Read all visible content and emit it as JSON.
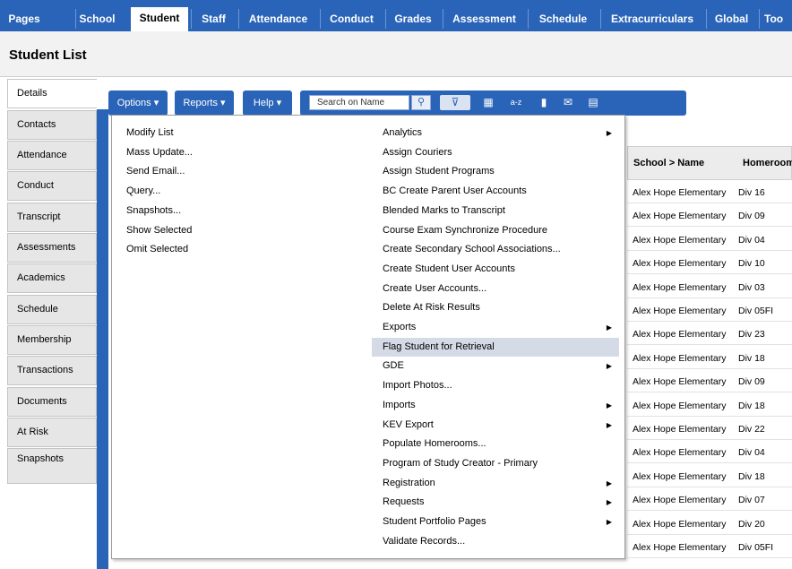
{
  "top_tabs": [
    "Pages",
    "School",
    "Student",
    "Staff",
    "Attendance",
    "Conduct",
    "Grades",
    "Assessment",
    "Schedule",
    "Extracurriculars",
    "Global",
    "Too"
  ],
  "active_top_tab": "Student",
  "page_title": "Student List",
  "side_tabs": [
    "Details",
    "Contacts",
    "Attendance",
    "Conduct",
    "Transcript",
    "Assessments",
    "Academics",
    "Schedule",
    "Membership",
    "Transactions",
    "Documents",
    "At Risk",
    "Snapshots"
  ],
  "toolbar": {
    "options_label": "Options",
    "reports_label": "Reports",
    "help_label": "Help",
    "search_placeholder": "Search on Name"
  },
  "options_menu": [
    "Modify List",
    "Mass Update...",
    "Send Email...",
    "Query...",
    "Snapshots...",
    "Show Selected",
    "Omit Selected"
  ],
  "submenu": [
    {
      "label": "Analytics",
      "arrow": true
    },
    {
      "label": "Assign Couriers",
      "arrow": false
    },
    {
      "label": "Assign Student Programs",
      "arrow": false
    },
    {
      "label": "BC Create Parent User Accounts",
      "arrow": false
    },
    {
      "label": "Blended Marks to Transcript",
      "arrow": false
    },
    {
      "label": "Course Exam Synchronize Procedure",
      "arrow": false
    },
    {
      "label": "Create Secondary School Associations...",
      "arrow": false
    },
    {
      "label": "Create Student User Accounts",
      "arrow": false
    },
    {
      "label": "Create User Accounts...",
      "arrow": false
    },
    {
      "label": "Delete At Risk Results",
      "arrow": false
    },
    {
      "label": "Exports",
      "arrow": true
    },
    {
      "label": "Flag Student for Retrieval",
      "arrow": false,
      "highlighted": true
    },
    {
      "label": "GDE",
      "arrow": true
    },
    {
      "label": "Import Photos...",
      "arrow": false
    },
    {
      "label": "Imports",
      "arrow": true
    },
    {
      "label": "KEV Export",
      "arrow": true
    },
    {
      "label": "Populate Homerooms...",
      "arrow": false
    },
    {
      "label": "Program of Study Creator - Primary",
      "arrow": false
    },
    {
      "label": "Registration",
      "arrow": true
    },
    {
      "label": "Requests",
      "arrow": true
    },
    {
      "label": "Student Portfolio Pages",
      "arrow": true
    },
    {
      "label": "Validate Records...",
      "arrow": false
    }
  ],
  "table": {
    "headers": [
      "School > Name",
      "Homeroom"
    ],
    "rows": [
      [
        "Alex Hope Elementary",
        "Div 16"
      ],
      [
        "Alex Hope Elementary",
        "Div 09"
      ],
      [
        "Alex Hope Elementary",
        "Div 04"
      ],
      [
        "Alex Hope Elementary",
        "Div 10"
      ],
      [
        "Alex Hope Elementary",
        "Div 03"
      ],
      [
        "Alex Hope Elementary",
        "Div 05FI"
      ],
      [
        "Alex Hope Elementary",
        "Div 23"
      ],
      [
        "Alex Hope Elementary",
        "Div 18"
      ],
      [
        "Alex Hope Elementary",
        "Div 09"
      ],
      [
        "Alex Hope Elementary",
        "Div 18"
      ],
      [
        "Alex Hope Elementary",
        "Div 22"
      ],
      [
        "Alex Hope Elementary",
        "Div 04"
      ],
      [
        "Alex Hope Elementary",
        "Div 18"
      ],
      [
        "Alex Hope Elementary",
        "Div 07"
      ],
      [
        "Alex Hope Elementary",
        "Div 20"
      ],
      [
        "Alex Hope Elementary",
        "Div 05FI"
      ]
    ]
  },
  "colors": {
    "brand_blue": "#2a64b8",
    "highlight": "#d4dbe6"
  }
}
